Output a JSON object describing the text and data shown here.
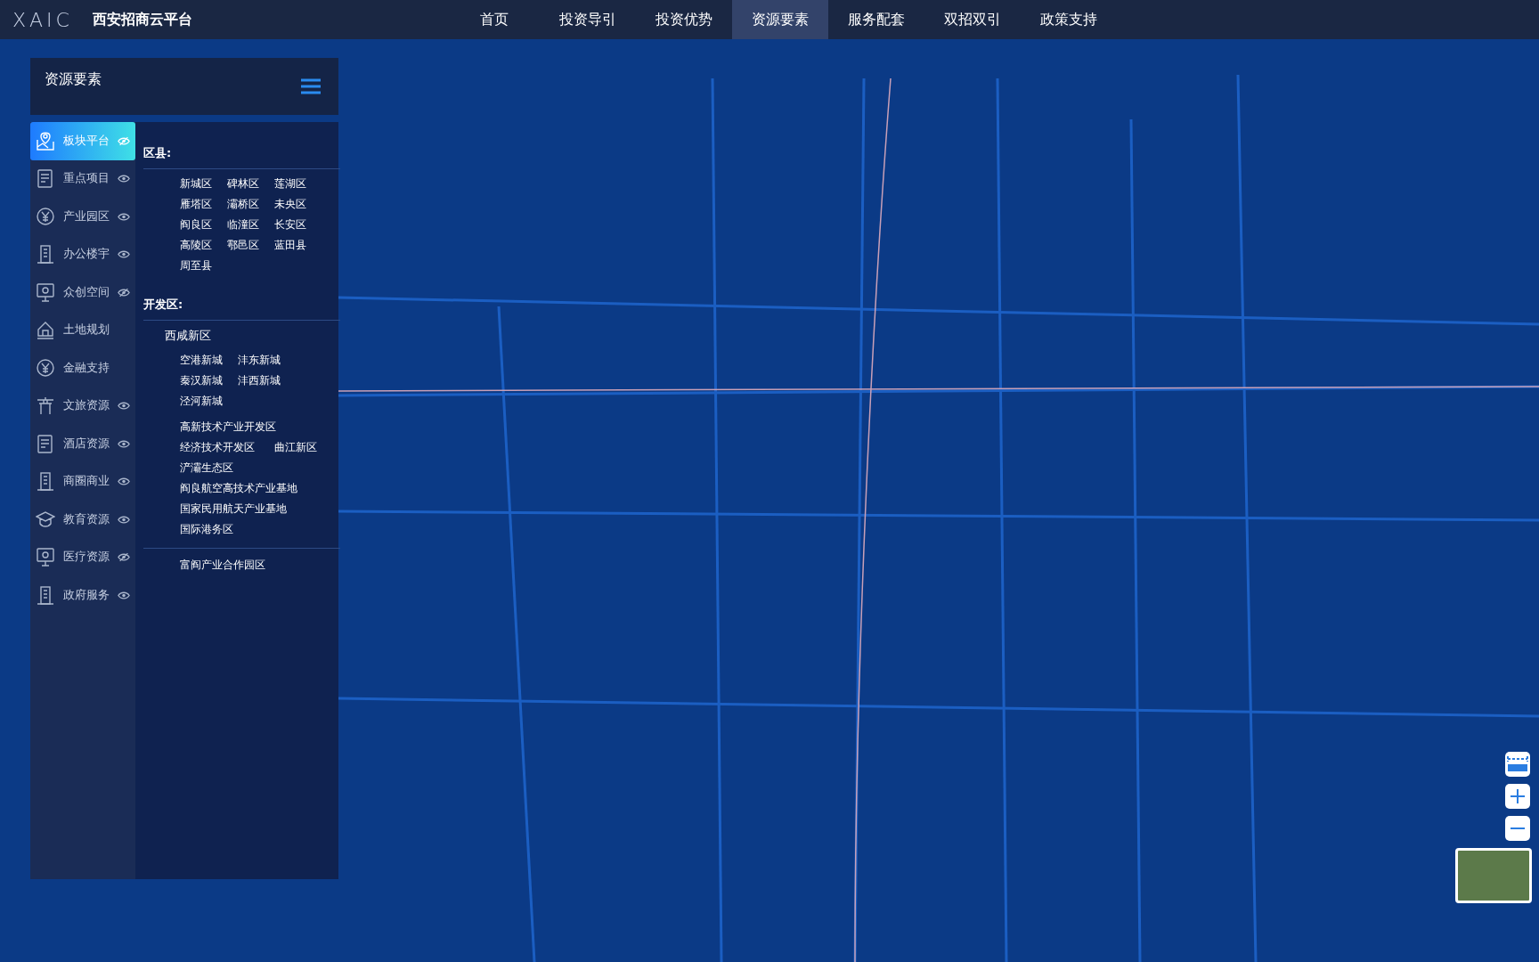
{
  "header": {
    "logo": "XAIC",
    "title": "西安招商云平台",
    "nav": [
      {
        "label": "首页",
        "selected": false
      },
      {
        "label": "投资导引",
        "selected": false
      },
      {
        "label": "投资优势",
        "selected": false
      },
      {
        "label": "资源要素",
        "selected": true
      },
      {
        "label": "服务配套",
        "selected": false
      },
      {
        "label": "双招双引",
        "selected": false
      },
      {
        "label": "政策支持",
        "selected": false
      }
    ]
  },
  "panel": {
    "title": "资源要素",
    "menu": [
      {
        "label": "板块平台",
        "kind": "toggle",
        "visible": false,
        "selected": true
      },
      {
        "label": "重点项目",
        "kind": "toggle",
        "visible": true,
        "selected": false
      },
      {
        "label": "产业园区",
        "kind": "toggle",
        "visible": true,
        "selected": false
      },
      {
        "label": "办公楼宇",
        "kind": "toggle",
        "visible": true,
        "selected": false
      },
      {
        "label": "众创空间",
        "kind": "toggle",
        "visible": false,
        "selected": false
      },
      {
        "label": "土地规划",
        "kind": "plain",
        "selected": false
      },
      {
        "label": "金融支持",
        "kind": "plain",
        "selected": false
      },
      {
        "label": "文旅资源",
        "kind": "toggle",
        "visible": true,
        "selected": false
      },
      {
        "label": "酒店资源",
        "kind": "toggle",
        "visible": true,
        "selected": false
      },
      {
        "label": "商圈商业",
        "kind": "toggle",
        "visible": true,
        "selected": false
      },
      {
        "label": "教育资源",
        "kind": "toggle",
        "visible": true,
        "selected": false
      },
      {
        "label": "医疗资源",
        "kind": "toggle",
        "visible": false,
        "selected": false
      },
      {
        "label": "政府服务",
        "kind": "toggle",
        "visible": true,
        "selected": false
      }
    ],
    "sections": [
      {
        "heading": "区县:",
        "groups": [
          {
            "items": [
              "新城区",
              "碑林区",
              "莲湖区",
              "雁塔区",
              "灞桥区",
              "未央区",
              "阎良区",
              "临潼区",
              "长安区",
              "高陵区",
              "鄠邑区",
              "蓝田县",
              "周至县"
            ]
          }
        ]
      },
      {
        "heading": "开发区:",
        "groups": [
          {
            "title": "西咸新区",
            "items": [
              "空港新城",
              "沣东新城",
              "秦汉新城",
              "沣西新城",
              "泾河新城"
            ]
          },
          {
            "items": [
              "高新技术产业开发区",
              "经济技术开发区",
              "曲江新区",
              "浐灞生态区",
              "阎良航空高技术产业基地",
              "国家民用航天产业基地",
              "国际港务区"
            ]
          }
        ]
      },
      {
        "groups": [
          {
            "items": [
              "富阎产业合作园区"
            ]
          }
        ]
      }
    ]
  }
}
